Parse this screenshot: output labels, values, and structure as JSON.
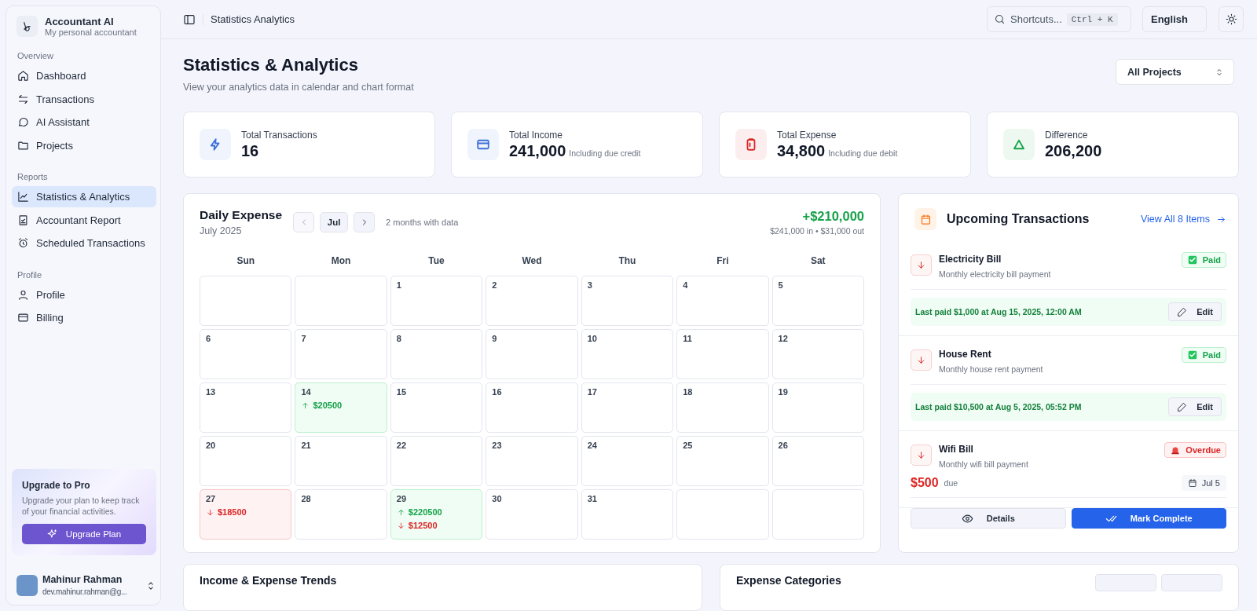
{
  "sidebar": {
    "app_name": "Accountant AI",
    "app_subtitle": "My personal accountant",
    "sections": [
      {
        "title": "Overview",
        "items": [
          {
            "label": "Dashboard",
            "selected": false
          },
          {
            "label": "Transactions",
            "selected": false
          },
          {
            "label": "AI Assistant",
            "selected": false
          },
          {
            "label": "Projects",
            "selected": false
          }
        ]
      },
      {
        "title": "Reports",
        "items": [
          {
            "label": "Statistics & Analytics",
            "selected": true
          },
          {
            "label": "Accountant Report",
            "selected": false
          },
          {
            "label": "Scheduled Transactions",
            "selected": false
          }
        ]
      },
      {
        "title": "Profile",
        "items": [
          {
            "label": "Profile",
            "selected": false
          },
          {
            "label": "Billing",
            "selected": false
          }
        ]
      }
    ],
    "upgrade": {
      "title": "Upgrade to Pro",
      "text": "Upgrade your plan to keep track of your financial activities.",
      "button": "Upgrade Plan"
    },
    "user": {
      "name": "Mahinur Rahman",
      "email": "dev.mahinur.rahman@g..."
    }
  },
  "header": {
    "breadcrumb": "Statistics Analytics",
    "search": {
      "placeholder": "Shortcuts...",
      "shortcut": "Ctrl + K"
    },
    "language": "English"
  },
  "page": {
    "title": "Statistics & Analytics",
    "subtitle": "View your analytics data in calendar and chart format",
    "project_select": "All Projects"
  },
  "stats": [
    {
      "label": "Total Transactions",
      "value": "16",
      "color": "#3b6fd8"
    },
    {
      "label": "Total Income",
      "value": "241,000",
      "note": "Including due credit",
      "color": "#3b6fd8"
    },
    {
      "label": "Total Expense",
      "value": "34,800",
      "note": "Including due debit",
      "color": "#dc2626"
    },
    {
      "label": "Difference",
      "value": "206,200",
      "color": "#16a34a"
    }
  ],
  "calendar": {
    "title": "Daily Expense",
    "subtitle": "July 2025",
    "month": "Jul",
    "months_note": "2 months with data",
    "net": "+$210,000",
    "summary": "$241,000 in • $31,000 out",
    "weekdays": [
      "Sun",
      "Mon",
      "Tue",
      "Wed",
      "Thu",
      "Fri",
      "Sat"
    ],
    "cells": [
      {
        "kind": "blank"
      },
      {
        "kind": "blank"
      },
      {
        "kind": "day",
        "day": "1"
      },
      {
        "kind": "day",
        "day": "2"
      },
      {
        "kind": "day",
        "day": "3"
      },
      {
        "kind": "day",
        "day": "4"
      },
      {
        "kind": "day",
        "day": "5"
      },
      {
        "kind": "day",
        "day": "6"
      },
      {
        "kind": "day",
        "day": "7"
      },
      {
        "kind": "day",
        "day": "8"
      },
      {
        "kind": "day",
        "day": "9"
      },
      {
        "kind": "day",
        "day": "10"
      },
      {
        "kind": "day",
        "day": "11"
      },
      {
        "kind": "day",
        "day": "12"
      },
      {
        "kind": "day",
        "day": "13"
      },
      {
        "kind": "day",
        "day": "14",
        "entries": [
          {
            "kind": "income",
            "amount": "$20500"
          }
        ]
      },
      {
        "kind": "day",
        "day": "15"
      },
      {
        "kind": "day",
        "day": "16"
      },
      {
        "kind": "day",
        "day": "17"
      },
      {
        "kind": "day",
        "day": "18"
      },
      {
        "kind": "day",
        "day": "19"
      },
      {
        "kind": "day",
        "day": "20"
      },
      {
        "kind": "day",
        "day": "21"
      },
      {
        "kind": "day",
        "day": "22"
      },
      {
        "kind": "day",
        "day": "23"
      },
      {
        "kind": "day",
        "day": "24"
      },
      {
        "kind": "day",
        "day": "25"
      },
      {
        "kind": "day",
        "day": "26"
      },
      {
        "kind": "day",
        "day": "27",
        "entries": [
          {
            "kind": "expense",
            "amount": "$18500"
          }
        ]
      },
      {
        "kind": "day",
        "day": "28"
      },
      {
        "kind": "day",
        "day": "29",
        "entries": [
          {
            "kind": "income",
            "amount": "$220500"
          },
          {
            "kind": "expense",
            "amount": "$12500"
          }
        ]
      },
      {
        "kind": "day",
        "day": "30"
      },
      {
        "kind": "day",
        "day": "31"
      },
      {
        "kind": "blank"
      },
      {
        "kind": "blank"
      }
    ]
  },
  "upcoming": {
    "title": "Upcoming Transactions",
    "link": "View All 8 Items",
    "items": [
      {
        "name": "Electricity Bill",
        "description": "Monthly electricity bill payment",
        "status": "Paid",
        "kind": "paid",
        "last_paid": "Last paid $1,000 at Aug 15, 2025, 12:00 AM",
        "action": "Edit"
      },
      {
        "name": "House Rent",
        "description": "Monthly house rent payment",
        "status": "Paid",
        "kind": "paid",
        "last_paid": "Last paid $10,500 at Aug 5, 2025, 05:52 PM",
        "action": "Edit"
      },
      {
        "name": "Wifi Bill",
        "description": "Monthly wifi bill payment",
        "status": "Overdue",
        "kind": "overdue",
        "amount": "$500",
        "amount_note": "due",
        "date": "Jul 5"
      }
    ],
    "buttons": [
      {
        "label": "Details",
        "kind": "secondary"
      },
      {
        "label": "Mark Complete",
        "kind": "primary"
      }
    ]
  },
  "panels": [
    {
      "title": "Income & Expense Trends",
      "has_controls": false
    },
    {
      "title": "Expense Categories",
      "has_controls": true
    }
  ]
}
